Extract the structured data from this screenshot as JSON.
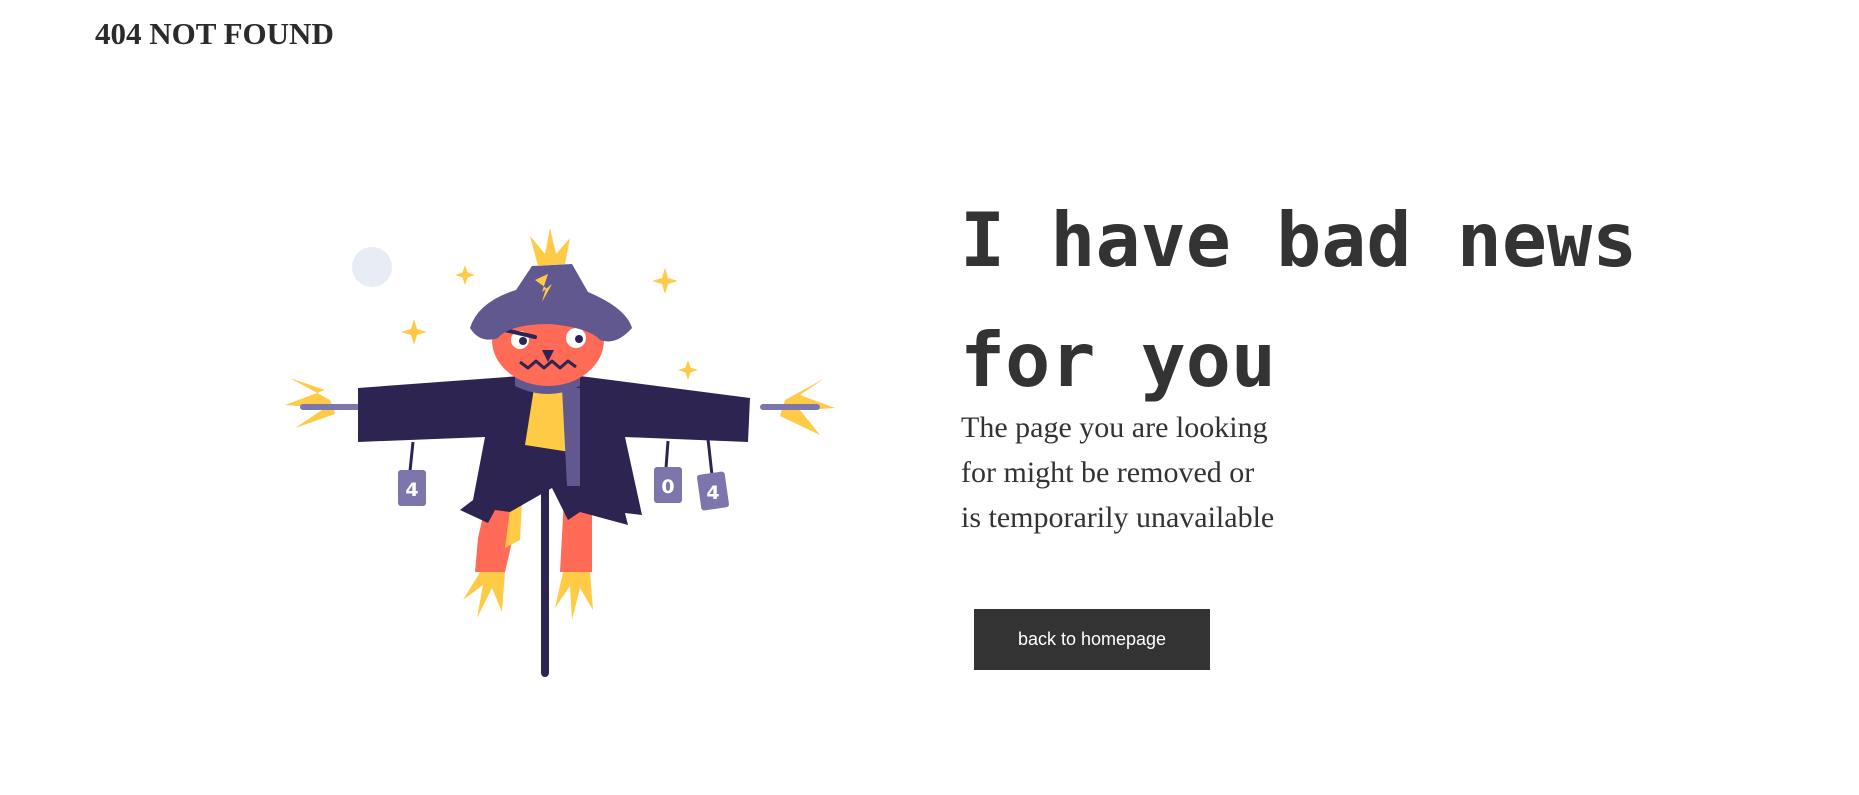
{
  "header": {
    "title": "404 NOT FOUND"
  },
  "main": {
    "headline_lines": [
      "I have bad news",
      "for you"
    ],
    "message_lines": [
      "The page you are looking",
      "for might be removed or",
      "is temporarily unavailable"
    ],
    "button_label": "back to homepage"
  },
  "illustration": {
    "subject": "scarecrow-icon",
    "can_labels": [
      "4",
      "0",
      "4"
    ],
    "colors": {
      "coat": "#2d2452",
      "hat": "#625890",
      "face": "#ff6b57",
      "straw": "#ffcb47",
      "can": "#7d76ad",
      "moon": "#e8ecf5"
    }
  },
  "theme": {
    "text": "#333333",
    "button_bg": "#333333",
    "button_text": "#ffffff",
    "background": "#ffffff"
  }
}
